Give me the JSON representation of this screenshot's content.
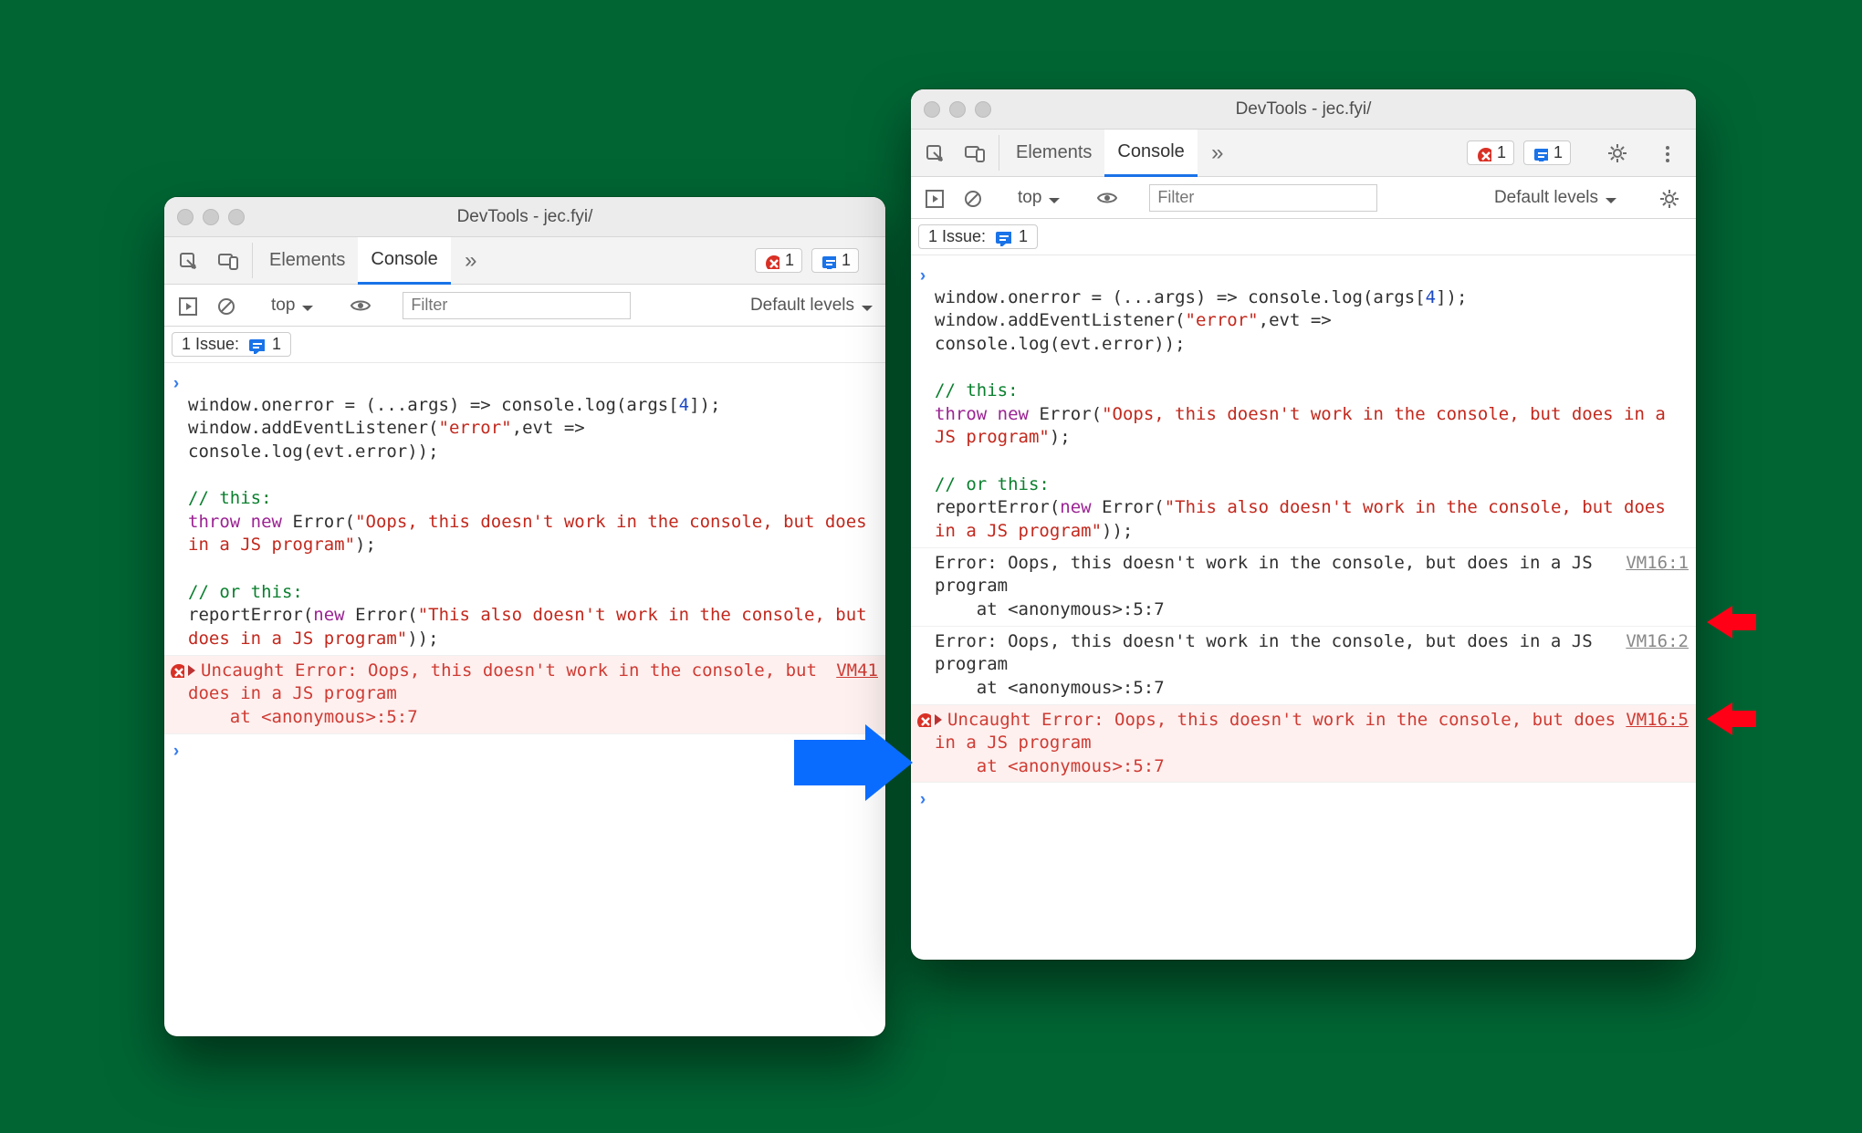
{
  "title": "DevTools - jec.fyi/",
  "tabs": {
    "elements": "Elements",
    "console": "Console"
  },
  "badges": {
    "errors": "1",
    "issues": "1"
  },
  "toolbar": {
    "context": "top",
    "filter_placeholder": "Filter",
    "levels": "Default levels",
    "issues_label": "1 Issue:",
    "issues_count": "1"
  },
  "code": {
    "l1a": "window.onerror = (...args) => console.log(args[",
    "l1b": "4",
    "l1c": "]);",
    "l2a": "window.addEventListener(",
    "l2b": "\"error\"",
    "l2c": ",evt =>",
    "l3": "console.log(evt.error));",
    "c1": "// this:",
    "t1a": "throw",
    "t1b": "new",
    "t1c": "Error(",
    "t1d": "\"Oops, this doesn't work in the console, but does in a JS program\"",
    "t1e": ");",
    "c2": "// or this:",
    "r1a": "reportError(",
    "r1b": "new",
    "r1c": "Error(",
    "r1d": "\"This also doesn't work in the console, but does in a JS program\"",
    "r1e": "));"
  },
  "out": {
    "err_left": "Uncaught Error: Oops, this doesn't work in the console, but does in a JS program\n    at <anonymous>:5:7",
    "src_left": "VM41",
    "log1": "Error: Oops, this doesn't work in the console, but does in a JS program\n    at <anonymous>:5:7",
    "src1": "VM16:1",
    "log2": "Error: Oops, this doesn't work in the console, but does in a JS program\n    at <anonymous>:5:7",
    "src2": "VM16:2",
    "err_right": "Uncaught Error: Oops, this doesn't work in the console, but does in a JS program\n    at <anonymous>:5:7",
    "src_right": "VM16:5"
  }
}
